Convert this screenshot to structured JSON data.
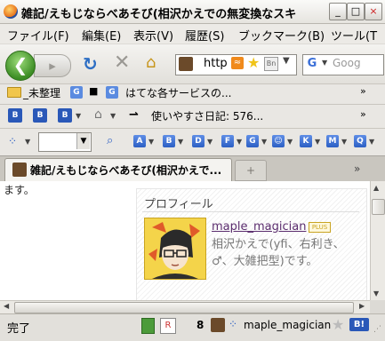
{
  "window": {
    "title": "雑記/えもじならべあそび(相沢かえでの無変換なスキ",
    "controls": [
      "_",
      "□",
      "×"
    ]
  },
  "menubar": [
    "ファイル(F)",
    "編集(E)",
    "表示(V)",
    "履歴(S)",
    "ブックマーク(B)",
    "ツール(T"
  ],
  "navbar": {
    "back_glyph": "❮",
    "forward_glyph": "▸",
    "reload_glyph": "↻",
    "stop_glyph": "✕",
    "home_glyph": "⌂",
    "url": "http",
    "search_placeholder": "Goog",
    "google_letter": "G"
  },
  "bookmarks": {
    "folder_label": "_未整理",
    "g_letter": "G",
    "square": "■",
    "hatena_label": "はてな各サービスの..."
  },
  "hatena_toolbar": {
    "diary_label": "使いやすさ日記: 576...",
    "b_letter": "B"
  },
  "google_toolbar": {
    "letters": [
      "A",
      "B",
      "D",
      "F",
      "G",
      "☺",
      "K",
      "M",
      "Q"
    ]
  },
  "tab": {
    "title": "雑記/えもじならべあそび(相沢かえで...",
    "new_tab_glyph": "+",
    "arrow": "»"
  },
  "content": {
    "snippet": "ます。",
    "profile_title": "プロフィール",
    "username": "maple_magician",
    "plus_badge": "PLUS",
    "bio": "相沢かえで(yfi、右利き、♂、大雑把型)です。"
  },
  "statusbar": {
    "status": "完了",
    "count": "8",
    "username": "maple_magician",
    "b_label": "B!"
  }
}
